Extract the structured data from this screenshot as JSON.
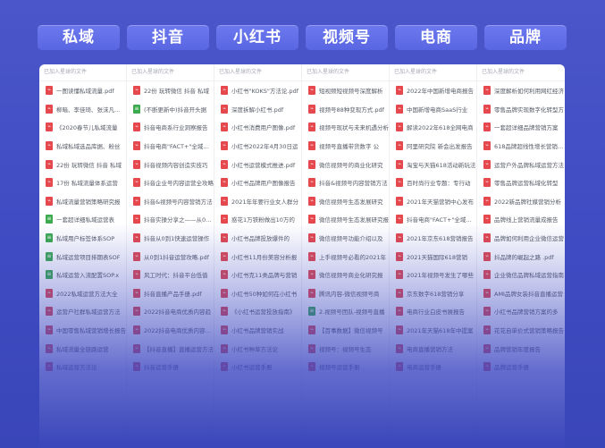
{
  "tabs": [
    "私域",
    "抖音",
    "小红书",
    "视频号",
    "电商",
    "品牌"
  ],
  "colors": {
    "background": "#4350c4",
    "tab": "#5f6ce6",
    "pdf_icon": "#e5484d",
    "sheet_icon": "#3cab4f"
  },
  "icons": {
    "pdf": "pdf-file-icon",
    "sheet": "spreadsheet-file-icon"
  },
  "columns": [
    {
      "header": "已加入星球的文件",
      "files": [
        {
          "name": "一图读懂私域流量.pdf",
          "type": "pdf"
        },
        {
          "name": "柳暗、李佳琦、张沫凡...",
          "type": "pdf"
        },
        {
          "name": "《2020春节儿私域流量",
          "type": "pdf"
        },
        {
          "name": "私域私域选品库据、粉丝",
          "type": "pdf"
        },
        {
          "name": "22份 玩转微信 抖音 私域",
          "type": "pdf"
        },
        {
          "name": "17份 私域流量体系运营",
          "type": "pdf"
        },
        {
          "name": "私域流量营销策略研究报",
          "type": "pdf"
        },
        {
          "name": "一套超详细私域运营表",
          "type": "xls"
        },
        {
          "name": "私域用户标签体系SOP",
          "type": "xls"
        },
        {
          "name": "私域运营项目排期表SOF",
          "type": "xls"
        },
        {
          "name": "私域运营入流配置SOP.x",
          "type": "xls"
        },
        {
          "name": "2022私域运营方法大全",
          "type": "pdf"
        },
        {
          "name": "运营户社群私域运营方法",
          "type": "pdf"
        },
        {
          "name": "中国零售私域营销增长报告",
          "type": "pdf"
        },
        {
          "name": "私域流量全链路运营",
          "type": "pdf"
        },
        {
          "name": "私域运营方法论",
          "type": "pdf"
        }
      ]
    },
    {
      "header": "已加入星球的文件",
      "files": [
        {
          "name": "22份 玩转微信 抖音 私域",
          "type": "pdf"
        },
        {
          "name": "(不断更新中)抖音开头据",
          "type": "xls"
        },
        {
          "name": "抖音电商系行业洞察报告",
          "type": "pdf"
        },
        {
          "name": "抖音电商\"FACT+\"全域经营",
          "type": "pdf"
        },
        {
          "name": "抖音视频内容创造实技巧",
          "type": "pdf"
        },
        {
          "name": "抖音企业号内容运营全攻略",
          "type": "pdf"
        },
        {
          "name": "抖音&视频号内容营销方法",
          "type": "pdf"
        },
        {
          "name": "抖音实操分享之——从0到1",
          "type": "pdf"
        },
        {
          "name": "抖音从0到1快速运营操作",
          "type": "pdf"
        },
        {
          "name": "从0到1抖音运营攻略.pdf",
          "type": "pdf"
        },
        {
          "name": "风工时代：抖音平台低值",
          "type": "pdf"
        },
        {
          "name": "抖音直播产品手册.pdf",
          "type": "pdf"
        },
        {
          "name": "2022抖音电商优质内容趋",
          "type": "pdf"
        },
        {
          "name": "2022抖音电商优质内容趋势",
          "type": "pdf"
        },
        {
          "name": "【抖音直播】直播运营方法",
          "type": "pdf"
        },
        {
          "name": "抖音运营手册",
          "type": "pdf"
        }
      ]
    },
    {
      "header": "已加入星球的文件",
      "files": [
        {
          "name": "小红书\"KOKS\"方法论.pdf",
          "type": "pdf"
        },
        {
          "name": "深度拆解小红书.pdf",
          "type": "pdf"
        },
        {
          "name": "小红书消费用户图像.pdf",
          "type": "pdf"
        },
        {
          "name": "小红书2022年4月30日运",
          "type": "pdf"
        },
        {
          "name": "小红书运营模式推进.pdf",
          "type": "pdf"
        },
        {
          "name": "小红书品牌用户图像报告",
          "type": "pdf"
        },
        {
          "name": "2021年年要行业女人群分",
          "type": "pdf"
        },
        {
          "name": "惑花1万铁粉做出10万的",
          "type": "pdf"
        },
        {
          "name": "小红书品牌投放爆件的",
          "type": "pdf"
        },
        {
          "name": "小红书11月份美容分析报",
          "type": "pdf"
        },
        {
          "name": "小红书克11类品牌与营销",
          "type": "pdf"
        },
        {
          "name": "小红书50种如何在小红书",
          "type": "pdf"
        },
        {
          "name": "《小红书运营投放指南》",
          "type": "pdf"
        },
        {
          "name": "小红书品牌营销实战",
          "type": "pdf"
        },
        {
          "name": "小红书种草方法论",
          "type": "pdf"
        },
        {
          "name": "小红书运营手册",
          "type": "pdf"
        }
      ]
    },
    {
      "header": "已加入星球的文件",
      "files": [
        {
          "name": "短视频短视频号深度解析",
          "type": "pdf"
        },
        {
          "name": "视频号88种变现方式.pdf",
          "type": "pdf"
        },
        {
          "name": "视频号现状与未来机遇分析",
          "type": "pdf"
        },
        {
          "name": "视频号直播带货数字 公",
          "type": "pdf"
        },
        {
          "name": "微信视频号的商业化研究",
          "type": "pdf"
        },
        {
          "name": "抖音&视频号内容营销方法",
          "type": "pdf"
        },
        {
          "name": "微信视频号生态发展研究",
          "type": "pdf"
        },
        {
          "name": "微信视频号生态发展研究报",
          "type": "pdf"
        },
        {
          "name": "微信视频号功能介绍以及",
          "type": "pdf"
        },
        {
          "name": "上手视频号必看的2021年",
          "type": "pdf"
        },
        {
          "name": "微信视频号商业化研究报",
          "type": "pdf"
        },
        {
          "name": "腾讯内容-微信视频号商",
          "type": "pdf"
        },
        {
          "name": "2.视频号团队-视频号直播",
          "type": "xls"
        },
        {
          "name": "【百事数据】微信视频号",
          "type": "pdf"
        },
        {
          "name": "视频号：视频号生态",
          "type": "pdf"
        },
        {
          "name": "视频号运营手册",
          "type": "pdf"
        }
      ]
    },
    {
      "header": "已加入星球的文件",
      "files": [
        {
          "name": "2022年中国新增电商报告",
          "type": "pdf"
        },
        {
          "name": "中国新增电商SaaS行业",
          "type": "pdf"
        },
        {
          "name": "解读2022年618全网电商",
          "type": "pdf"
        },
        {
          "name": "阿里研究院 新会出发报告",
          "type": "pdf"
        },
        {
          "name": "淘宝与天猫618活动新玩法",
          "type": "pdf"
        },
        {
          "name": "百时尚行业专题：专行动",
          "type": "pdf"
        },
        {
          "name": "2021年天猫营销中心发布",
          "type": "pdf"
        },
        {
          "name": "抖音电商\"FACT+\"全域经营",
          "type": "pdf"
        },
        {
          "name": "2021年京东618营销报告",
          "type": "pdf"
        },
        {
          "name": "2021天猫国际618营销",
          "type": "pdf"
        },
        {
          "name": "2021年视频号发生了哪些",
          "type": "pdf"
        },
        {
          "name": "京东数字618营销分享",
          "type": "pdf"
        },
        {
          "name": "电商行业白皮书展报告",
          "type": "pdf"
        },
        {
          "name": "2021年天猫618年中提案",
          "type": "pdf"
        },
        {
          "name": "电商直播营销方法",
          "type": "pdf"
        },
        {
          "name": "电商运营手册",
          "type": "pdf"
        }
      ]
    },
    {
      "header": "已加入星球的文件",
      "files": [
        {
          "name": "深度解析如何利用网红经济",
          "type": "pdf"
        },
        {
          "name": "零售品牌实现数字化转型方",
          "type": "pdf"
        },
        {
          "name": "一套超详细品牌营销方案",
          "type": "pdf"
        },
        {
          "name": "618品牌超线性增长营销报告",
          "type": "pdf"
        },
        {
          "name": "运营户外品牌私域运营方法",
          "type": "pdf"
        },
        {
          "name": "零售品牌运营私域化转型",
          "type": "pdf"
        },
        {
          "name": "2022新品牌社媒营销分析",
          "type": "pdf"
        },
        {
          "name": "品牌线上营销流量成报告",
          "type": "pdf"
        },
        {
          "name": "品牌如何利用企业微信运营",
          "type": "pdf"
        },
        {
          "name": "抖品牌的崛起之路 .pdf",
          "type": "pdf"
        },
        {
          "name": "企业微信品牌私域运营指南",
          "type": "pdf"
        },
        {
          "name": "AMI品牌女装抖音直播运营",
          "type": "pdf"
        },
        {
          "name": "小红书品牌营销方案的多",
          "type": "pdf"
        },
        {
          "name": "花花自单价式营销策略报告",
          "type": "pdf"
        },
        {
          "name": "品牌营销年度报告",
          "type": "pdf"
        },
        {
          "name": "品牌运营手册",
          "type": "pdf"
        }
      ]
    }
  ]
}
